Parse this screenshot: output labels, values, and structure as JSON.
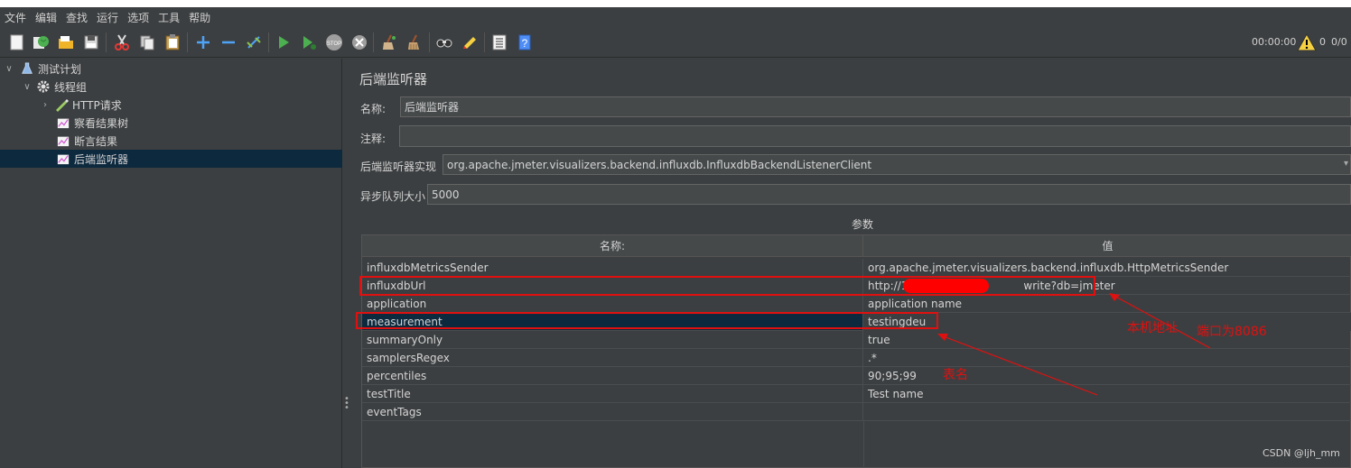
{
  "menu": {
    "items": [
      "文件",
      "编辑",
      "查找",
      "运行",
      "选项",
      "工具",
      "帮助"
    ]
  },
  "toolbar": {
    "icons": [
      "new-icon",
      "templates-icon",
      "open-icon",
      "save-icon",
      "cut-icon",
      "copy-icon",
      "paste-icon",
      "expand-icon",
      "collapse-icon",
      "toggle-icon",
      "start-icon",
      "start-no-pause-icon",
      "stop-icon",
      "shutdown-icon",
      "clear-icon",
      "clear-all-icon",
      "search-icon",
      "reset-search-icon",
      "function-helper-icon",
      "help-icon"
    ],
    "timer": "00:00:00",
    "warning_count": "0",
    "thread_count": "0/0"
  },
  "tree": {
    "items": [
      {
        "label": "测试计划",
        "icon": "test-plan-icon"
      },
      {
        "label": "线程组",
        "icon": "thread-group-gear-icon"
      },
      {
        "label": "HTTP请求",
        "icon": "http-sampler-pen-icon"
      },
      {
        "label": "察看结果树",
        "icon": "listener-chart-icon"
      },
      {
        "label": "断言结果",
        "icon": "listener-chart-icon"
      },
      {
        "label": "后端监听器",
        "icon": "listener-chart-icon"
      }
    ]
  },
  "panel": {
    "title": "后端监听器",
    "name_label": "名称:",
    "name_value": "后端监听器",
    "comment_label": "注释:",
    "comment_value": "",
    "impl_label": "后端监听器实现",
    "impl_value": "org.apache.jmeter.visualizers.backend.influxdb.InfluxdbBackendListenerClient",
    "queue_label": "异步队列大小",
    "queue_value": "5000",
    "params_title": "参数"
  },
  "params_table": {
    "headers": [
      "名称:",
      "值"
    ],
    "rows": [
      {
        "name": "influxdbMetricsSender",
        "value": "org.apache.jmeter.visualizers.backend.influxdb.HttpMetricsSender"
      },
      {
        "name": "influxdbUrl",
        "value": "http://1",
        "value_tail": "write?db=jmeter"
      },
      {
        "name": "application",
        "value": "application name"
      },
      {
        "name": "measurement",
        "value": "testingdeu"
      },
      {
        "name": "summaryOnly",
        "value": "true"
      },
      {
        "name": "samplersRegex",
        "value": ".*"
      },
      {
        "name": "percentiles",
        "value": "90;95;99"
      },
      {
        "name": "testTitle",
        "value": "Test name"
      },
      {
        "name": "eventTags",
        "value": ""
      }
    ]
  },
  "annotations": {
    "local_address": "本机地址",
    "port_note": "端口为8086",
    "table_name": "表名",
    "color": "#e01010"
  },
  "watermark": "CSDN @ljh_mm",
  "colors": {
    "background": "#3c3f41",
    "selection": "#0d293e",
    "field": "#45494a"
  }
}
